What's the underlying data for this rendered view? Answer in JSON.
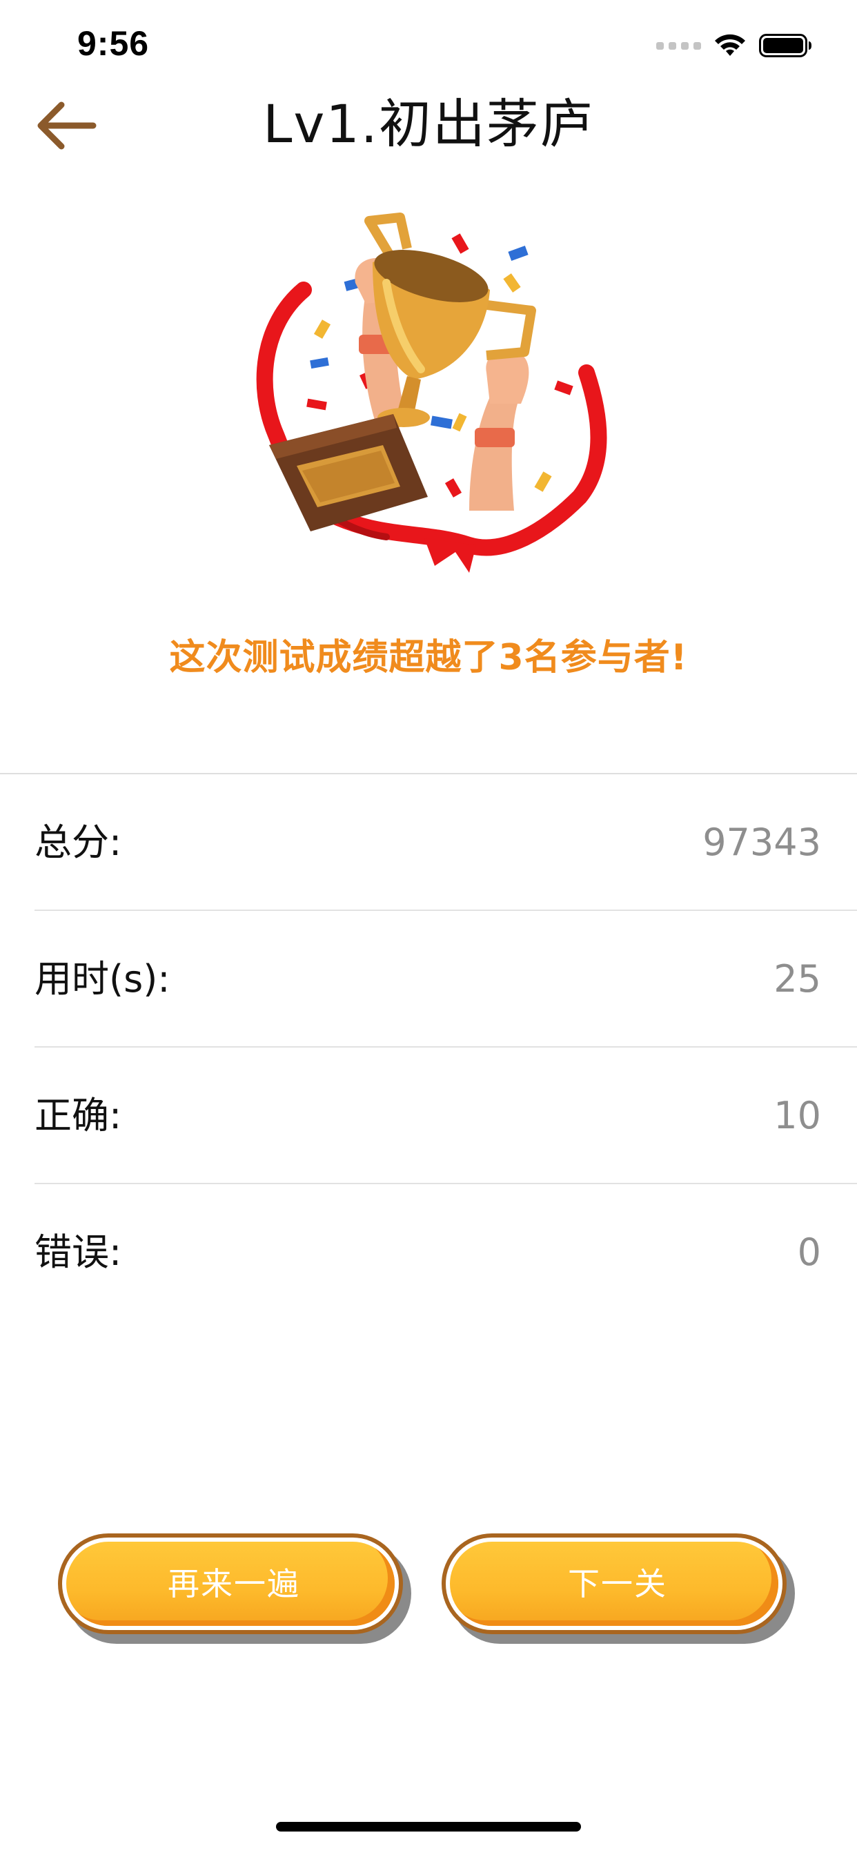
{
  "status_bar": {
    "time": "9:56"
  },
  "nav": {
    "title": "Lv1.初出茅庐",
    "back_icon": "arrow-left-icon"
  },
  "result": {
    "message": "这次测试成绩超越了3名参与者!"
  },
  "stats": [
    {
      "label": "总分:",
      "value": "97343"
    },
    {
      "label": "用时(s):",
      "value": "25"
    },
    {
      "label": "正确:",
      "value": "10"
    },
    {
      "label": "错误:",
      "value": "0"
    }
  ],
  "buttons": {
    "retry_label": "再来一遍",
    "next_label": "下一关"
  },
  "colors": {
    "accent_orange": "#F08B1D",
    "button_yellow": "#FDB92B",
    "button_border": "#A9651F",
    "back_arrow": "#8B5A2B",
    "value_gray": "#8e8e8e"
  }
}
